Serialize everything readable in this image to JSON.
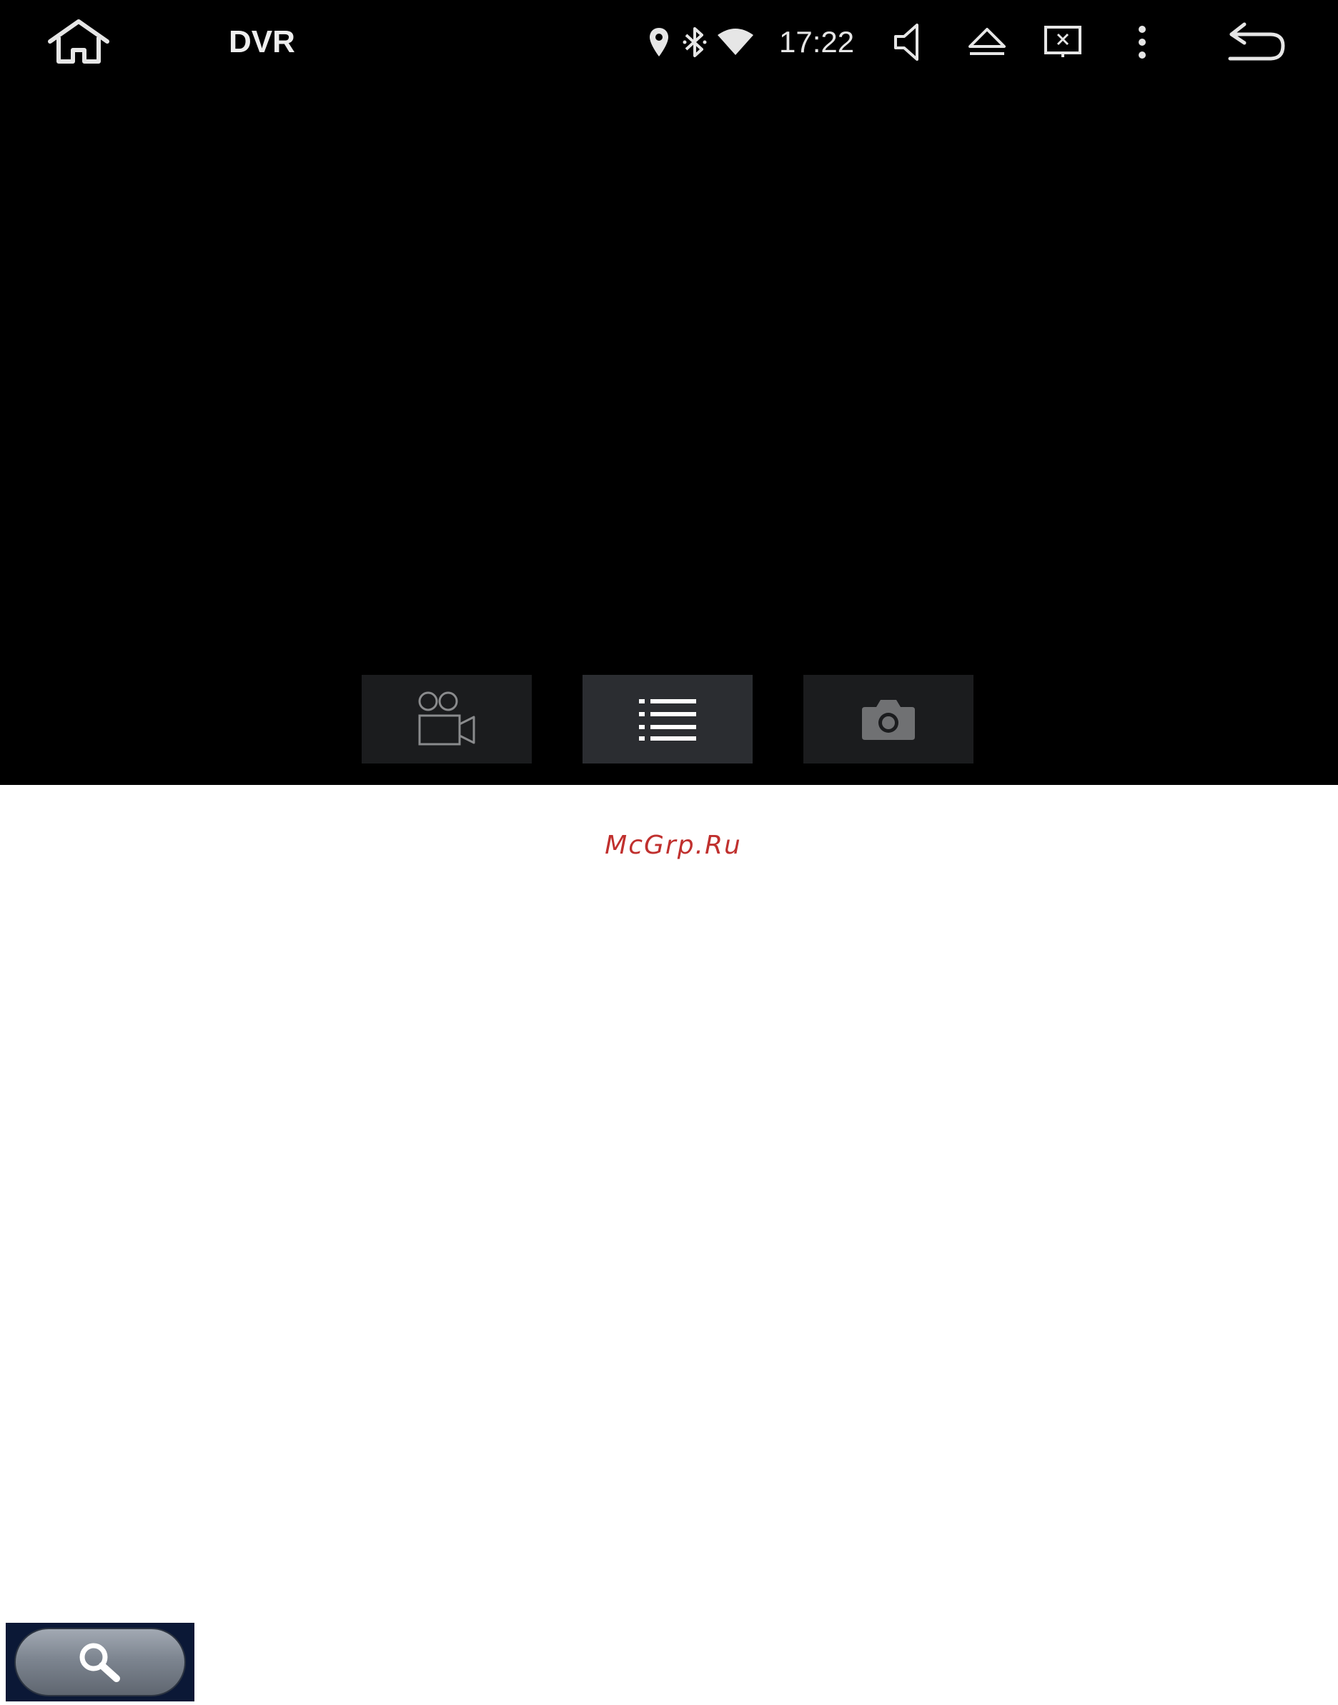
{
  "statusbar": {
    "title": "DVR",
    "time": "17:22",
    "icons": [
      "home-icon",
      "location-icon",
      "bluetooth-icon",
      "wifi-icon",
      "volume-icon",
      "eject-icon",
      "screen-off-icon",
      "more-vert-icon",
      "back-icon"
    ]
  },
  "controls": {
    "buttons": [
      "record-icon",
      "list-icon",
      "camera-icon"
    ],
    "active": "list-icon"
  },
  "watermark": "McGrp.Ru",
  "search_widget": {
    "icon": "search-icon"
  },
  "colors": {
    "screen_bg": "#000000",
    "button_bg": "#1b1c1e",
    "button_active_bg": "#2b2d31",
    "watermark": "#c0302e"
  }
}
